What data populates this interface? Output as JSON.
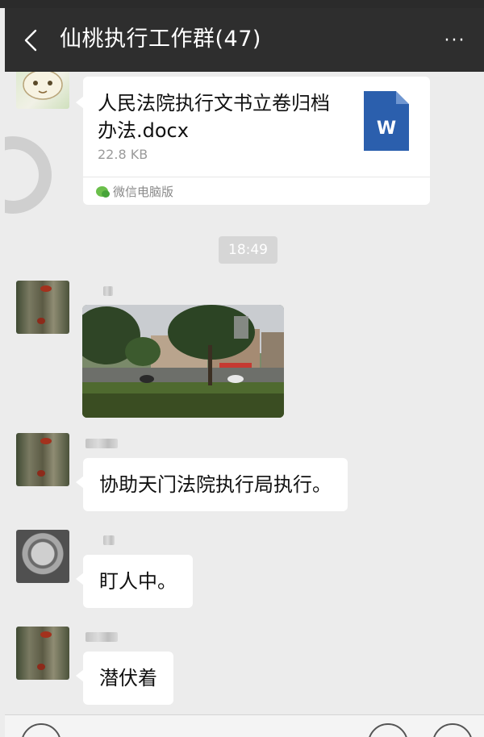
{
  "header": {
    "title": "仙桃执行工作群(47)",
    "back_icon": "chevron-left-icon",
    "more_label": "···"
  },
  "messages": {
    "file": {
      "file_name": "人民法院执行文书立卷归档办法.docx",
      "file_size": "22.8 KB",
      "file_type_letter": "W",
      "source": "微信电脑版"
    },
    "timestamp": "18:49",
    "text_1": "协助天门法院执行局执行。",
    "text_2": "盯人中。",
    "text_3": "潜伏着"
  },
  "colors": {
    "nav_bg": "#2e2e2e",
    "chat_bg": "#ececec",
    "bubble_bg": "#ffffff",
    "word_blue": "#2b5fad"
  }
}
